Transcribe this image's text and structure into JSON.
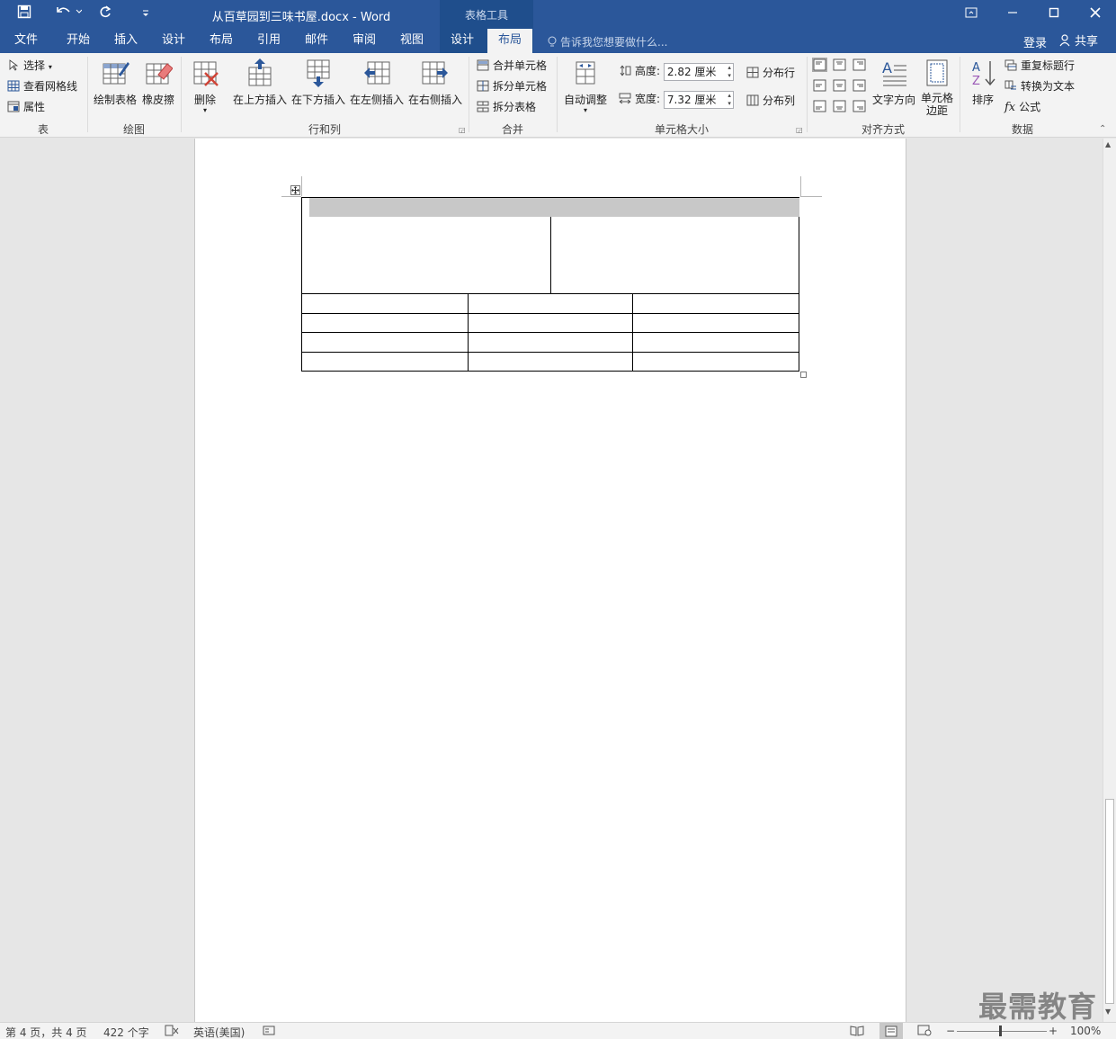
{
  "titlebar": {
    "doc_title": "从百草园到三味书屋.docx - Word",
    "tools_title": "表格工具"
  },
  "tabs": [
    {
      "label": "文件"
    },
    {
      "label": "开始"
    },
    {
      "label": "插入"
    },
    {
      "label": "设计"
    },
    {
      "label": "布局"
    },
    {
      "label": "引用"
    },
    {
      "label": "邮件"
    },
    {
      "label": "审阅"
    },
    {
      "label": "视图"
    },
    {
      "label": "设计"
    },
    {
      "label": "布局"
    }
  ],
  "tellme": "告诉我您想要做什么...",
  "login": "登录",
  "share": "共享",
  "ribbon": {
    "table": {
      "select": "选择",
      "gridlines": "查看网格线",
      "properties": "属性",
      "label": "表"
    },
    "draw": {
      "draw_table": "绘制表格",
      "eraser": "橡皮擦",
      "label": "绘图"
    },
    "rowscols": {
      "delete": "删除",
      "insert_above": "在上方插入",
      "insert_below": "在下方插入",
      "insert_left": "在左侧插入",
      "insert_right": "在右侧插入",
      "label": "行和列"
    },
    "merge": {
      "merge_cells": "合并单元格",
      "split_cells": "拆分单元格",
      "split_table": "拆分表格",
      "label": "合并"
    },
    "cellsize": {
      "autofit": "自动调整",
      "height_label": "高度:",
      "height_value": "2.82 厘米",
      "width_label": "宽度:",
      "width_value": "7.32 厘米",
      "distribute_rows": "分布行",
      "distribute_cols": "分布列",
      "label": "单元格大小"
    },
    "alignment": {
      "text_direction": "文字方向",
      "cell_margins_1": "单元格",
      "cell_margins_2": "边距",
      "label": "对齐方式"
    },
    "data": {
      "sort": "排序",
      "repeat_header": "重复标题行",
      "convert_text": "转换为文本",
      "formula": "公式",
      "label": "数据"
    }
  },
  "status": {
    "page": "第 4 页，共 4 页",
    "words": "422 个字",
    "language": "英语(美国)",
    "zoom": "100%"
  },
  "watermark": "最需教育",
  "colors": {
    "titlebar": "#2b579a",
    "tools": "#1f4e8c"
  }
}
